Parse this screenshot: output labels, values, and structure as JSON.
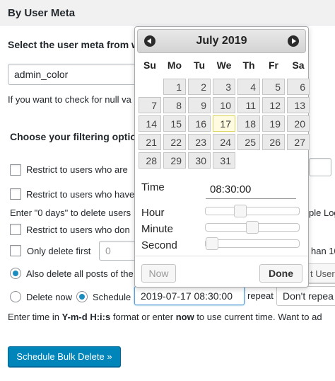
{
  "section": {
    "title": "By User Meta"
  },
  "meta": {
    "select_label": "Select the user meta from wh",
    "value": "admin_color",
    "null_hint": "If you want to check for null va"
  },
  "filters": {
    "heading": "Choose your filtering options",
    "restrict_1": "Restrict to users who are",
    "restrict_2": "Restrict to users who have",
    "days_hint": "Enter \"0 days\" to delete users",
    "days_hint_tail": "ple Log",
    "restrict_3": "Restrict to users who don",
    "only_delete": "Only delete first",
    "only_delete_value": "0",
    "only_delete_tail": "han 10",
    "also_delete": "Also delete all posts of the",
    "user_btn": "t User"
  },
  "schedule": {
    "delete_now": "Delete now",
    "schedule_label": "Schedule",
    "datetime_value": "2019-07-17 08:30:00",
    "repeat_label": "repeat",
    "repeat_select": "Don't repea",
    "hint_prefix": "Enter time in ",
    "hint_format": "Y-m-d H:i:s",
    "hint_mid": " format or enter ",
    "hint_now": "now",
    "hint_suffix": " to use current time. Want to ad",
    "submit": "Schedule Bulk Delete »"
  },
  "datepicker": {
    "month_title": "July 2019",
    "weekdays": [
      "Su",
      "Mo",
      "Tu",
      "We",
      "Th",
      "Fr",
      "Sa"
    ],
    "days": [
      "1",
      "2",
      "3",
      "4",
      "5",
      "6",
      "7",
      "8",
      "9",
      "10",
      "11",
      "12",
      "13",
      "14",
      "15",
      "16",
      "17",
      "18",
      "19",
      "20",
      "21",
      "22",
      "23",
      "24",
      "25",
      "26",
      "27",
      "28",
      "29",
      "30",
      "31"
    ],
    "today": "17",
    "time_label": "Time",
    "time_value": "08:30:00",
    "hour_label": "Hour",
    "minute_label": "Minute",
    "second_label": "Second",
    "now_btn": "Now",
    "done_btn": "Done",
    "hour_fraction": 0.35,
    "minute_fraction": 0.5,
    "second_fraction": 0.0
  }
}
